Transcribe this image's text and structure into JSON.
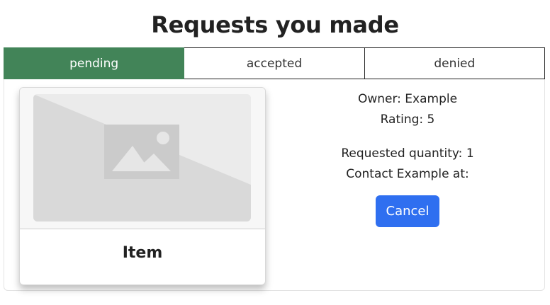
{
  "page": {
    "title": "Requests you made"
  },
  "tabs": [
    {
      "label": "pending",
      "active": true
    },
    {
      "label": "accepted",
      "active": false
    },
    {
      "label": "denied",
      "active": false
    }
  ],
  "item_card": {
    "image_icon": "image-placeholder-icon",
    "title": "Item"
  },
  "details": {
    "owner": "Owner: Example",
    "rating": "Rating: 5",
    "requested_quantity": "Requested quantity: 1",
    "contact": "Contact Example at:",
    "cancel_label": "Cancel"
  },
  "colors": {
    "active_tab": "#428458",
    "button": "#2f6ff0"
  }
}
